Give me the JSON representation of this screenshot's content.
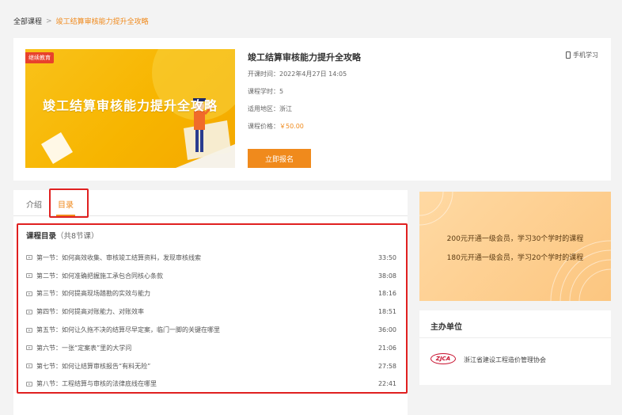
{
  "breadcrumb": {
    "root": "全部课程",
    "separator": ">",
    "current": "竣工结算审核能力提升全攻略"
  },
  "course": {
    "cover_badge": "继续教育",
    "cover_title": "竣工结算审核能力提升全攻略",
    "title": "竣工结算审核能力提升全攻略",
    "start_label": "开课时间：",
    "start_value": "2022年4月27日 14:05",
    "hours_label": "课程学时：",
    "hours_value": "5",
    "region_label": "适用地区：",
    "region_value": "浙江",
    "price_label": "课程价格：",
    "price_value": "￥50.00",
    "enroll_label": "立即报名",
    "mobile_label": "手机学习"
  },
  "tabs": {
    "intro": "介绍",
    "catalog": "目录"
  },
  "catalog": {
    "heading": "课程目录",
    "count": "（共8节课）",
    "lessons": [
      {
        "name": "第一节：如何高效收集、审核竣工结算资料，发现审核线索",
        "duration": "33:50"
      },
      {
        "name": "第二节：如何准确把握施工承包合同核心条款",
        "duration": "38:08"
      },
      {
        "name": "第三节：如何提高现场踏勘的实效与能力",
        "duration": "18:16"
      },
      {
        "name": "第四节：如何提高对账能力、对账效率",
        "duration": "18:51"
      },
      {
        "name": "第五节：如何让久拖不决的结算尽早定案，临门一脚的关键在哪里",
        "duration": "36:00"
      },
      {
        "name": "第六节：一张“定案表”里的大学问",
        "duration": "21:06"
      },
      {
        "name": "第七节：如何让结算审核报告“有料无险”",
        "duration": "27:58"
      },
      {
        "name": "第八节：工程结算与审核的法律底线在哪里",
        "duration": "22:41"
      }
    ]
  },
  "promo": {
    "line1": "200元开通一级会员，学习30个学时的课程",
    "line2": "180元开通一级会员，学习20个学时的课程"
  },
  "sponsor": {
    "heading": "主办单位",
    "logo_text": "ZJCA",
    "org_name": "浙江省建设工程造价管理协会"
  },
  "colors": {
    "accent": "#f08a1c",
    "highlight_border": "#e02020",
    "cover_yellow": "#f7b500"
  }
}
